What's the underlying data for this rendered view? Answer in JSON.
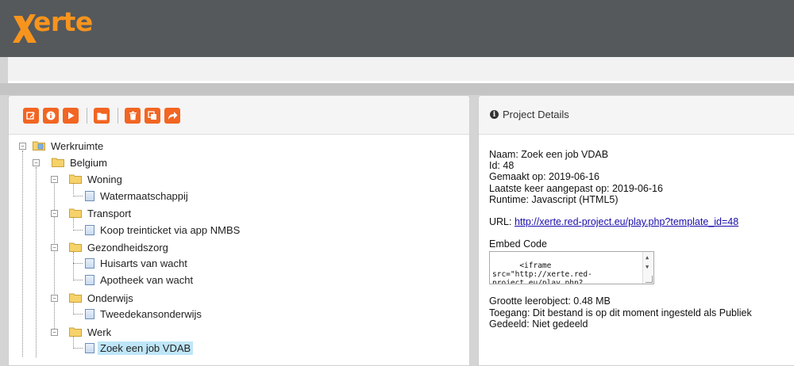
{
  "app": {
    "logo_text": "erte",
    "brand_color": "#f7941d"
  },
  "toolbar": {
    "buttons": [
      {
        "icon": "edit-icon"
      },
      {
        "icon": "info-icon"
      },
      {
        "icon": "play-icon"
      },
      {
        "icon": "folder-icon"
      },
      {
        "icon": "trash-icon"
      },
      {
        "icon": "duplicate-icon"
      },
      {
        "icon": "share-icon"
      }
    ],
    "accent_color": "#f26522"
  },
  "tree": {
    "root": "Werkruimte",
    "belgium": "Belgium",
    "woning": "Woning",
    "watermaatschappij": "Watermaatschappij",
    "transport": "Transport",
    "koop": "Koop treinticket via app NMBS",
    "gezondheidszorg": "Gezondheidszorg",
    "huisarts": "Huisarts van wacht",
    "apotheek": "Apotheek van wacht",
    "onderwijs": "Onderwijs",
    "tweedekans": "Tweedekansonderwijs",
    "werk": "Werk",
    "zoek": "Zoek een job VDAB"
  },
  "details": {
    "title": "Project Details",
    "naam": "Naam: Zoek een job VDAB",
    "id": "Id: 48",
    "gemaakt": "Gemaakt op: 2019-06-16",
    "aangepast": "Laatste keer aangepast op: 2019-06-16",
    "runtime": "Runtime: Javascript (HTML5)",
    "url_label": "URL: ",
    "url": "http://xerte.red-project.eu/play.php?template_id=48",
    "embed_label": "Embed Code",
    "embed_code": "<iframe\nsrc=\"http://xerte.red-\nproject.eu/play.php?",
    "grootte": "Grootte leerobject: 0.48 MB",
    "toegang": "Toegang: Dit bestand is op dit moment ingesteld als Publiek",
    "gedeeld": "Gedeeld: Niet gedeeld"
  }
}
